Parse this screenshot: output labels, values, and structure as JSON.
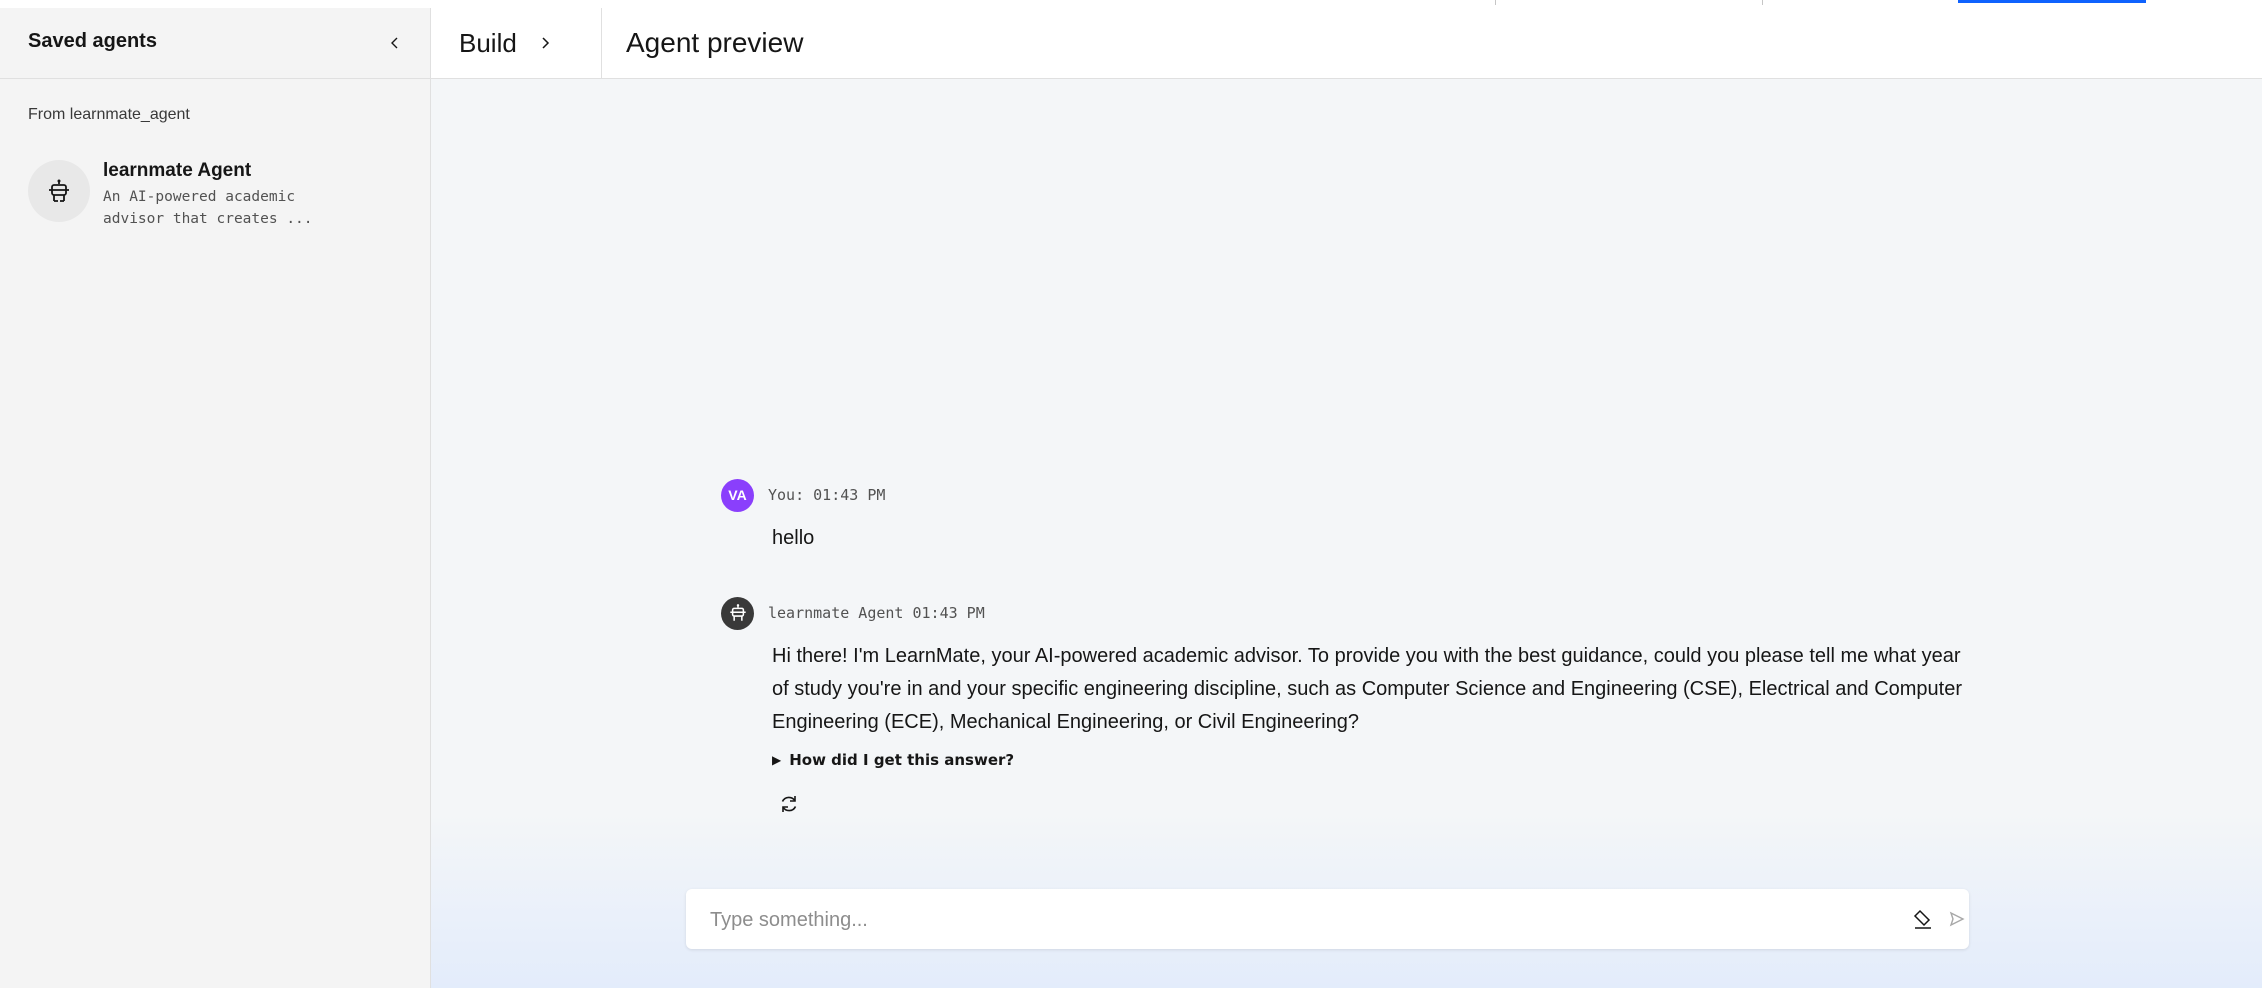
{
  "sidebar": {
    "title": "Saved agents",
    "group_label": "From learnmate_agent",
    "agents": [
      {
        "name": "learnmate Agent",
        "description": "An AI-powered academic advisor that creates ..."
      }
    ]
  },
  "header": {
    "breadcrumb": "Build",
    "title": "Agent preview"
  },
  "chat": {
    "messages": [
      {
        "sender": "You",
        "avatar_initials": "VA",
        "meta": "You: 01:43 PM",
        "text": "hello"
      },
      {
        "sender": "learnmate Agent",
        "meta": "learnmate Agent 01:43 PM",
        "text": "Hi there! I'm LearnMate, your AI-powered academic advisor. To provide you with the best guidance, could you please tell me what year of study you're in and your specific engineering discipline, such as Computer Science and Engineering (CSE), Electrical and Computer Engineering (ECE), Mechanical Engineering, or Civil Engineering?",
        "explain_label": "How did I get this answer?"
      }
    ]
  },
  "composer": {
    "placeholder": "Type something..."
  },
  "icons": {
    "collapse": "chevron-left-icon",
    "breadcrumb": "chevron-right-icon",
    "agent": "robot-icon",
    "regenerate": "refresh-icon",
    "clear": "eraser-icon",
    "send": "send-icon"
  },
  "colors": {
    "user_avatar": "#8a3ffc",
    "bot_avatar": "#393939",
    "accent": "#0f62fe"
  }
}
